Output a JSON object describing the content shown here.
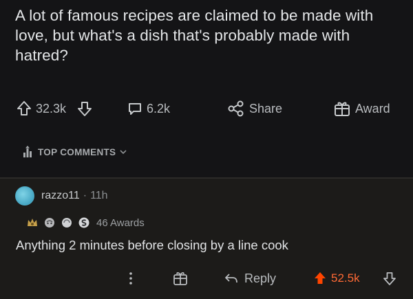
{
  "post": {
    "title": "A lot of famous recipes are claimed to be made with love, but what's a dish that's probably made with hatred?"
  },
  "post_actions": {
    "upvote_count": "32.3k",
    "comment_count": "6.2k",
    "share_label": "Share",
    "award_label": "Award"
  },
  "sort": {
    "label": "TOP COMMENTS"
  },
  "comment": {
    "username": "razzo11",
    "separator": "·",
    "age": "11h",
    "awards_count": "46 Awards",
    "body": "Anything 2 minutes before closing by a line cook",
    "reply_label": "Reply",
    "score": "52.5k"
  },
  "colors": {
    "background": "#141416",
    "comment_background": "#1c1b19",
    "upvoted": "#ff4500",
    "avatar": "#4aa7c1"
  },
  "icons": [
    "upvote-icon",
    "downvote-icon",
    "comment-icon",
    "share-icon",
    "award-icon",
    "sort-icon",
    "chevron-down-icon",
    "more-icon",
    "gift-icon",
    "reply-icon"
  ]
}
